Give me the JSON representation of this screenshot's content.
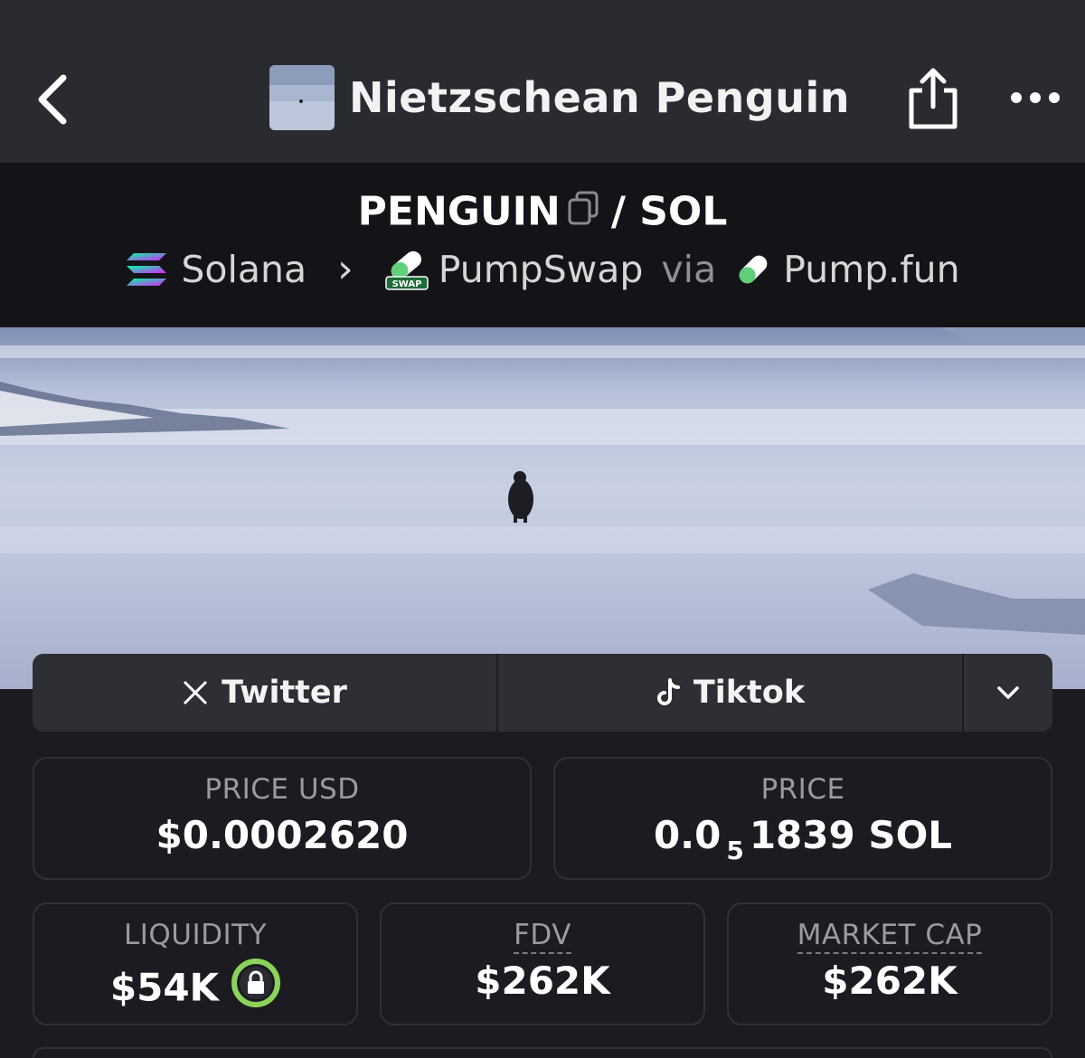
{
  "header": {
    "title": "Nietzschean Penguin"
  },
  "pair": {
    "base": "PENGUIN",
    "separator": "/",
    "quote": "SOL"
  },
  "chain": {
    "network": "Solana",
    "arrow": "›",
    "dex": "PumpSwap",
    "via": "via",
    "launchpad": "Pump.fun",
    "swap_badge": "SWAP"
  },
  "socials": {
    "twitter_label": "Twitter",
    "tiktok_label": "Tiktok"
  },
  "stats": {
    "price_usd_label": "PRICE USD",
    "price_usd_value": "$0.0002620",
    "price_label": "PRICE",
    "price_prefix": "0.0",
    "price_zeros": "5",
    "price_suffix": "1839 SOL",
    "liquidity_label": "LIQUIDITY",
    "liquidity_value": "$54K",
    "fdv_label": "FDV",
    "fdv_value": "$262K",
    "mcap_label": "MARKET CAP",
    "mcap_value": "$262K"
  },
  "colors": {
    "accent_green": "#8bd35a",
    "bg": "#1b1b21",
    "topbar": "#2a2b31"
  }
}
